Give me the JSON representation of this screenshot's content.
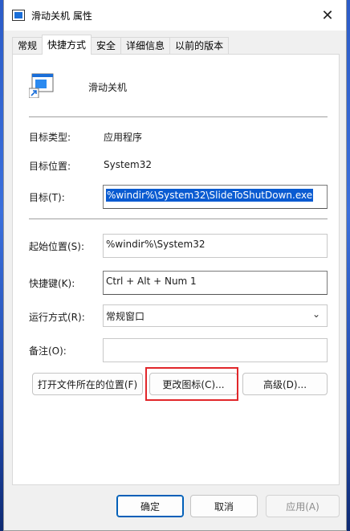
{
  "window": {
    "title": "滑动关机 属性",
    "close_glyph": "✕"
  },
  "tabs": [
    {
      "label": "常规",
      "active": false
    },
    {
      "label": "快捷方式",
      "active": true
    },
    {
      "label": "安全",
      "active": false
    },
    {
      "label": "详细信息",
      "active": false
    },
    {
      "label": "以前的版本",
      "active": false
    }
  ],
  "shortcut": {
    "name": "滑动关机",
    "target_type_label": "目标类型:",
    "target_type_value": "应用程序",
    "target_location_label": "目标位置:",
    "target_location_value": "System32",
    "target_label": "目标(T):",
    "target_value": "%windir%\\System32\\SlideToShutDown.exe",
    "start_in_label": "起始位置(S):",
    "start_in_value": "%windir%\\System32",
    "shortcut_key_label": "快捷键(K):",
    "shortcut_key_value": "Ctrl + Alt + Num 1",
    "run_label": "运行方式(R):",
    "run_value": "常规窗口",
    "comment_label": "备注(O):",
    "comment_value": ""
  },
  "buttons": {
    "open_location": "打开文件所在的位置(F)",
    "change_icon": "更改图标(C)...",
    "advanced": "高级(D)...",
    "ok": "确定",
    "cancel": "取消",
    "apply": "应用(A)"
  },
  "colors": {
    "accent": "#005fb8",
    "selection": "#0a5bd1",
    "highlight_box": "#e1262a"
  }
}
